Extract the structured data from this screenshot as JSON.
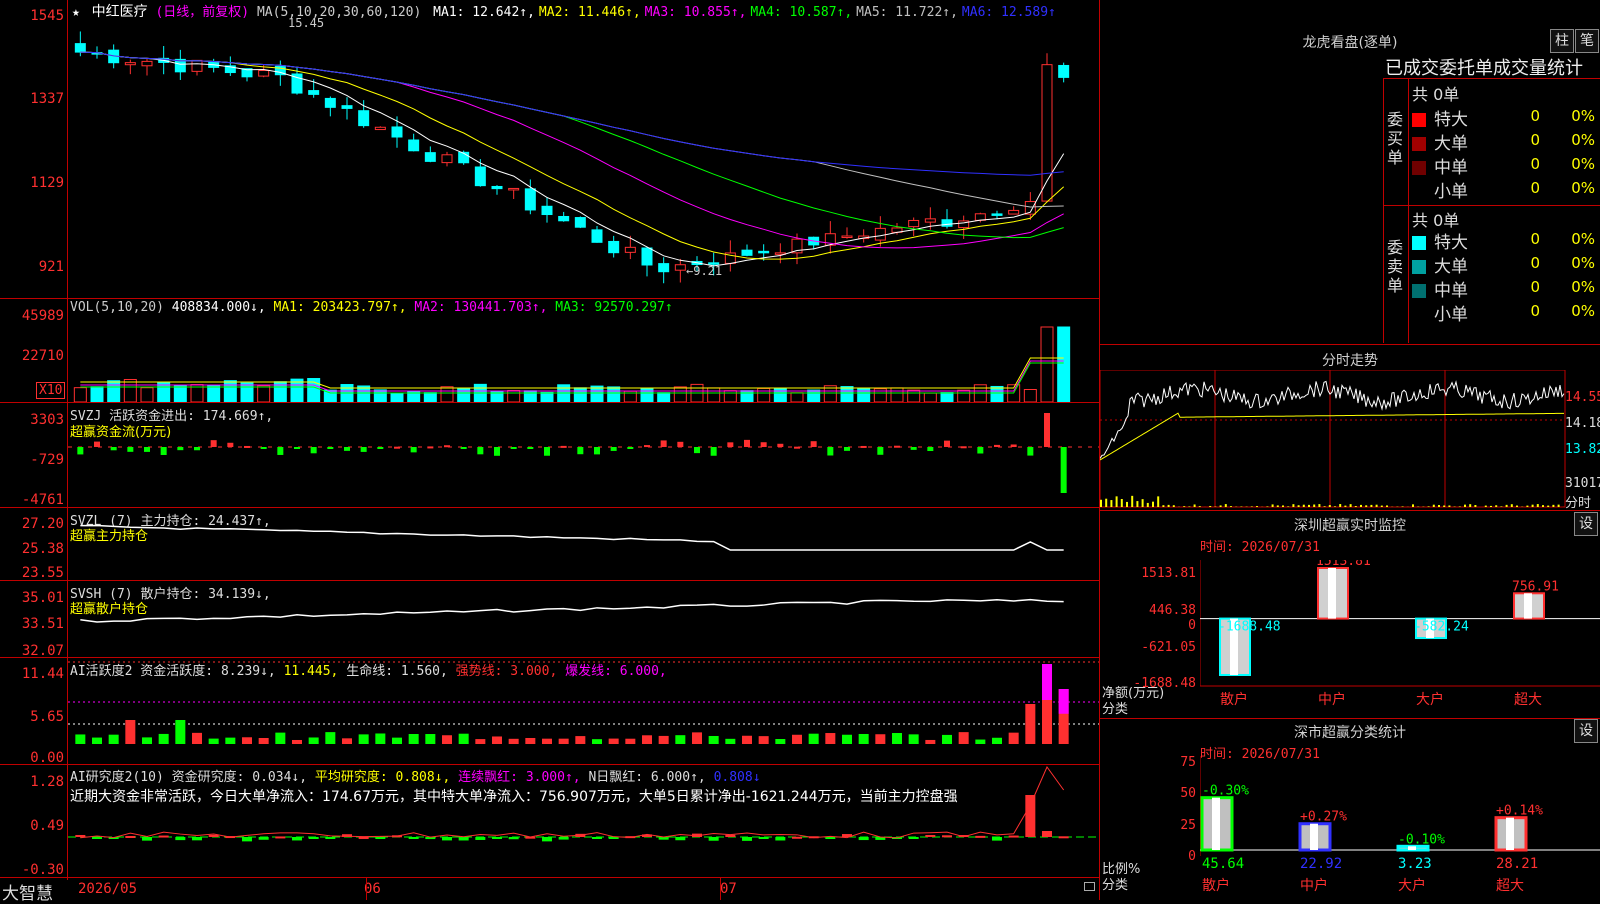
{
  "header": {
    "star": "★",
    "stock_name": "中红医疗",
    "period": "(日线，前复权)",
    "ma_params": "MA(5,10,20,30,60,120)",
    "ma_values": [
      {
        "label": "MA1: 12.642↑,",
        "color": "#ffffff"
      },
      {
        "label": "MA2: 11.446↑,",
        "color": "#ffff00"
      },
      {
        "label": "MA3: 10.855↑,",
        "color": "#ff00ff"
      },
      {
        "label": "MA4: 10.587↑,",
        "color": "#00ff00"
      },
      {
        "label": "MA5: 11.722↑,",
        "color": "#c0c0c0"
      },
      {
        "label": "MA6: 12.589↑",
        "color": "#3030ff"
      }
    ],
    "price_high": "15.45",
    "price_low": "←9.21"
  },
  "axes": {
    "price": [
      "1545",
      "1337",
      "1129",
      "921"
    ],
    "vol": [
      "45989",
      "22710"
    ],
    "vol_unit": "X10",
    "svzj": [
      "3303",
      "-729",
      "-4761"
    ],
    "svzl": [
      "27.20",
      "25.38",
      "23.55"
    ],
    "svsh": [
      "35.01",
      "33.51",
      "32.07"
    ],
    "ai2": [
      "11.44",
      "5.65",
      "0.00"
    ],
    "ai_research": [
      "1.28",
      "0.49",
      "-0.30"
    ]
  },
  "indicators": {
    "vol": {
      "label": "VOL(5,10,20)",
      "value": "408834.000↓,",
      "ma1": "MA1: 203423.797↑,",
      "ma2": "MA2: 130441.703↑,",
      "ma3": "MA3: 92570.297↑"
    },
    "svzj": {
      "label": "SVZJ  活跃资金进出: 174.669↑,",
      "sub": "超赢资金流(万元)"
    },
    "svzl": {
      "label": "SVZL (7) 主力持仓: 24.437↑,",
      "sub": "超赢主力持仓"
    },
    "svsh": {
      "label": "SVSH (7) 散户持仓: 34.139↓,",
      "sub": "超赢散户持仓"
    },
    "ai2": {
      "label": "AI活跃度2 资金活跃度: 8.239↓,",
      "v2": "11.445,",
      "v3": "生命线: 1.560,",
      "v4": "强势线: 3.000,",
      "v5": "爆发线: 6.000,"
    },
    "ai_research": {
      "label": "AI研究度2(10) 资金研究度: 0.034↓,",
      "v2": "平均研究度: 0.808↓,",
      "v3": "连续飘红: 3.000↑,",
      "v4": "N日飘红: 6.000↑,",
      "v5": "0.808↓",
      "desc": "近期大资金非常活跃，今日大单净流入：174.67万元，其中特大单净流入：756.907万元，大单5日累计净出-1621.244万元，当前主力控盘强"
    }
  },
  "dates": {
    "d1": "2026/05",
    "d2": "06",
    "d3": "07"
  },
  "brand": "大智慧",
  "dragon": {
    "title": "龙虎看盘(逐单)",
    "btn1": "柱",
    "btn2": "笔",
    "subtitle": "已成交委托单成交量统计",
    "buy_total": "共 0单",
    "sell_total": "共 0单",
    "buy_label": "委买单",
    "sell_label": "委卖单",
    "buy_rows": [
      {
        "name": "特大",
        "color": "#ff0000",
        "v": "0",
        "p": "0%"
      },
      {
        "name": "大单",
        "color": "#a00000",
        "v": "0",
        "p": "0%"
      },
      {
        "name": "中单",
        "color": "#700000",
        "v": "0",
        "p": "0%"
      },
      {
        "name": "小单",
        "color": "#000000",
        "v": "0",
        "p": "0%"
      }
    ],
    "sell_rows": [
      {
        "name": "特大",
        "color": "#00ffff",
        "v": "0",
        "p": "0%"
      },
      {
        "name": "大单",
        "color": "#00a0a0",
        "v": "0",
        "p": "0%"
      },
      {
        "name": "中单",
        "color": "#007070",
        "v": "0",
        "p": "0%"
      },
      {
        "name": "小单",
        "color": "#000000",
        "v": "0",
        "p": "0%"
      }
    ]
  },
  "timeshare": {
    "title": "分时走势",
    "prices": [
      "14.55",
      "14.18",
      "13.82"
    ],
    "vol": "31017",
    "unit": "分时"
  },
  "monitor": {
    "title": "深圳超赢实时监控",
    "btn": "设",
    "time": "时间: 2026/07/31",
    "axis": [
      "1513.81",
      "446.38",
      "0",
      "-621.05",
      "-1688.48"
    ],
    "axis_label": "净额(万元)",
    "axis_label2": "分类",
    "cats": [
      "散户",
      "中户",
      "大户",
      "超大"
    ],
    "values": [
      -1688.48,
      1513.81,
      -582.24,
      756.91
    ],
    "value_labels": [
      "-1688.48",
      "1513.81",
      "-582.24",
      "756.91"
    ]
  },
  "classify": {
    "title": "深市超赢分类统计",
    "btn": "设",
    "time": "时间: 2026/07/31",
    "axis": [
      "75",
      "50",
      "25",
      "0"
    ],
    "axis_label": "比例%",
    "axis_label2": "分类",
    "cats": [
      "散户",
      "中户",
      "大户",
      "超大"
    ],
    "values": [
      45.64,
      22.92,
      3.23,
      28.21
    ],
    "value_labels": [
      "45.64",
      "22.92",
      "3.23",
      "28.21"
    ],
    "changes": [
      "-0.30%",
      "+0.27%",
      "-0.10%",
      "+0.14%"
    ]
  },
  "colors": {
    "up": "#ff3030",
    "down": "#00ffff",
    "grid": "#c00000"
  }
}
